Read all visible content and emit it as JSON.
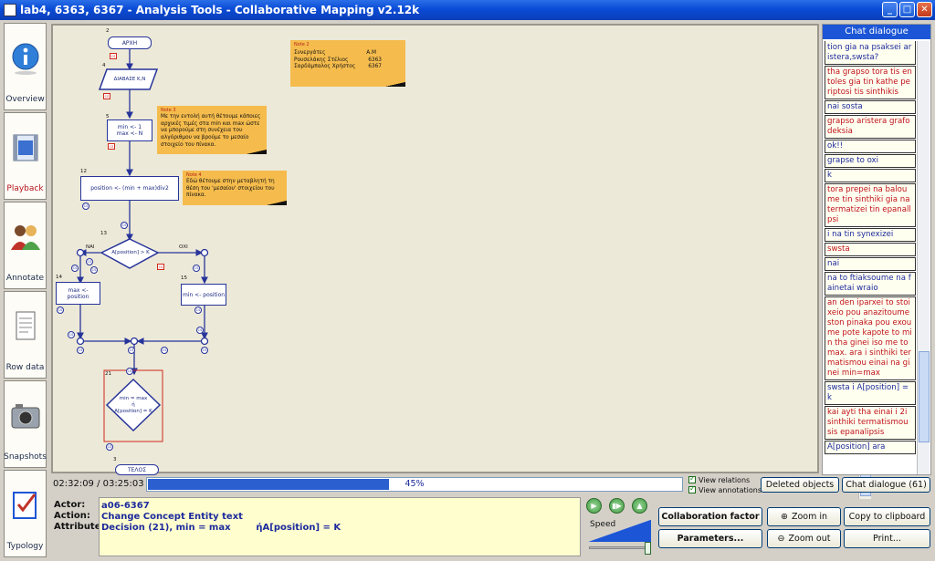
{
  "window": {
    "title": "lab4, 6363, 6367 - Analysis Tools - Collaborative Mapping v2.12k"
  },
  "sidebar": {
    "items": [
      {
        "label": "Overview",
        "icon": "info-icon"
      },
      {
        "label": "Playback",
        "icon": "film-icon"
      },
      {
        "label": "Annotate",
        "icon": "users-icon"
      },
      {
        "label": "Row data",
        "icon": "document-icon"
      },
      {
        "label": "Snapshots",
        "icon": "camera-icon"
      },
      {
        "label": "Typology",
        "icon": "checklist-icon"
      }
    ]
  },
  "diagram": {
    "nodes": {
      "start": {
        "num": "2",
        "text": "ΑΡΧΗ"
      },
      "read": {
        "num": "4",
        "text": "ΔΙΑΒΑΣΕ Κ,Ν"
      },
      "init_a": {
        "num": "5",
        "text": "min <- 1"
      },
      "init_b": {
        "text": "max <- N"
      },
      "position": {
        "num": "12",
        "text": "position <- (min + max)div2"
      },
      "decision": {
        "num": "13",
        "text": "A[position] > K"
      },
      "yes_label": "ΝΑΙ",
      "no_label": "ΟΧΙ",
      "left": {
        "num": "14",
        "text": "max <- position"
      },
      "right": {
        "num": "15",
        "text": "min <- position"
      },
      "loop": {
        "num": "21",
        "text_a": "min = max",
        "text_b": "ή",
        "text_c": "A[position] = K"
      },
      "end": {
        "num": "3",
        "text": "ΤΕΛΟΣ"
      },
      "cs": "CS"
    },
    "notes": {
      "n2": {
        "title": "Note 2",
        "header_a": "Συνεργάτες",
        "header_b": "Α.Μ",
        "row1_name": "Ρουσελάκης Στέλιος",
        "row1_id": "6363",
        "row2_name": "Σαρδάμπαλος Χρήστος",
        "row2_id": "6367"
      },
      "n3": {
        "title": "Note 3",
        "text": "Με την εντολή αυτή θέτουμε κάποιες αρχικές τιμές στα min και max ώστε να μπορούμε στη συνέχεια του αλγόριθμου να βρούμε το μεσαίο στοιχείο του πίνακα."
      },
      "n4": {
        "title": "Note 4",
        "text": "Εδώ θέτουμε στην μεταβλητή τη θέση του 'μεσαίου' στοιχείου του πίνακα."
      }
    }
  },
  "chat": {
    "header": "Chat dialogue",
    "messages": [
      {
        "text": "A[position] oro vazoume opou max to position gia na psaksei aristera,swsta?",
        "color": "blue"
      },
      {
        "text": "tha grapso tora tis entoles gia tin kathe periptosi tis sinthikis",
        "color": "red"
      },
      {
        "text": "nai sosta",
        "color": "blue"
      },
      {
        "text": "grapso aristera grafo deksia",
        "color": "red"
      },
      {
        "text": "ok!!",
        "color": "blue"
      },
      {
        "text": "grapse to oxi",
        "color": "blue"
      },
      {
        "text": "k",
        "color": "blue"
      },
      {
        "text": "tora prepei na baloume tin sinthiki gia na termatizei tin epanallpsi",
        "color": "red"
      },
      {
        "text": "i na tin synexizei",
        "color": "blue"
      },
      {
        "text": "swsta",
        "color": "red"
      },
      {
        "text": "nai",
        "color": "blue"
      },
      {
        "text": "na to ftiaksoume na fainetai wraio",
        "color": "blue"
      },
      {
        "text": "an den iparxei to stoixeio pou anazitoume ston pinaka pou exoume pote kapote to min tha ginei iso me to max. ara i sinthiki termatismou einai na ginei min=max",
        "color": "red"
      },
      {
        "text": "swsta i A[position] = k",
        "color": "blue"
      },
      {
        "text": "kai ayti tha einai i 2i sinthiki termatismou sis epanalipsis",
        "color": "red"
      },
      {
        "text": "A[position] ara",
        "color": "blue"
      }
    ]
  },
  "playback": {
    "time": "02:32:09 / 03:25:03",
    "progress_label": "45%",
    "progress": 0.45
  },
  "view": {
    "relations": "View relations",
    "annotations": "View annotations"
  },
  "buttons": {
    "deleted": "Deleted objects",
    "chat": "Chat dialogue (61)",
    "collab": "Collaboration factor",
    "params": "Parameters...",
    "zoom_in": "Zoom in",
    "zoom_out": "Zoom out",
    "copy": "Copy to clipboard",
    "print": "Print..."
  },
  "action": {
    "actor_key": "Actor:",
    "action_key": "Action:",
    "attributes_key": "Attributes:",
    "actor": "a06-6367",
    "action": "Change Concept Entity text",
    "attributes": "Decision (21), min = max        ήA[position] = K"
  },
  "speed": {
    "label": "Speed",
    "level": 0.9
  },
  "colors": {
    "titlebar": "#0a4bd6",
    "accent": "#1c56d6",
    "note": "#f5bc4d",
    "node_border": "#27349a"
  }
}
